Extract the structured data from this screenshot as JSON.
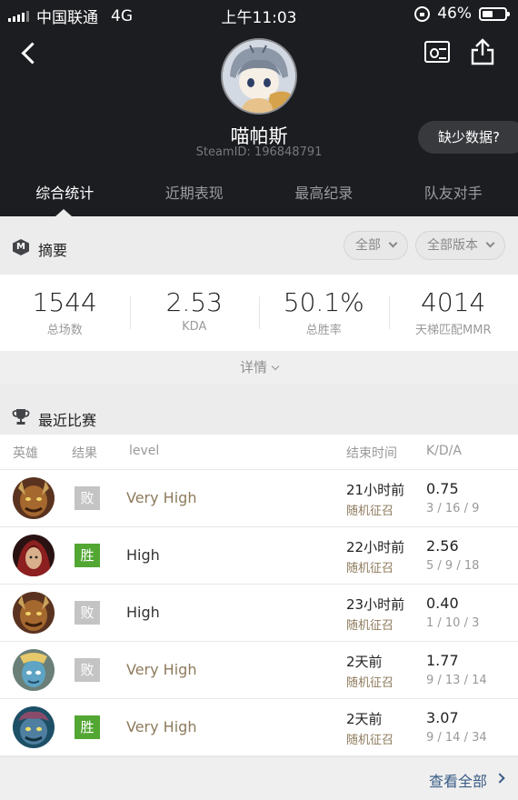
{
  "status_bar": {
    "carrier": "中国联通",
    "network": "4G",
    "time": "上午11:03",
    "battery": "46%",
    "battery_level": 0.46
  },
  "profile": {
    "name": "喵帕斯",
    "steam_id": "SteamID: 196848791",
    "missing_data_label": "缺少数据?"
  },
  "tabs": [
    {
      "label": "综合统计",
      "active": true
    },
    {
      "label": "近期表现",
      "active": false
    },
    {
      "label": "最高纪录",
      "active": false
    },
    {
      "label": "队友对手",
      "active": false
    }
  ],
  "summary": {
    "title": "摘要",
    "filter_all": "全部",
    "filter_version": "全部版本",
    "stats": [
      {
        "value": "1544",
        "label": "总场数"
      },
      {
        "value": "2.53",
        "label": "KDA"
      },
      {
        "value": "50.1%",
        "label": "总胜率"
      },
      {
        "value": "4014",
        "label": "天梯匹配MMR"
      }
    ],
    "details_label": "详情"
  },
  "recent": {
    "title": "最近比赛",
    "columns": {
      "hero": "英雄",
      "result": "结果",
      "level": "level",
      "end_time": "结束时间",
      "kda": "K/D/A"
    },
    "matches": [
      {
        "hero": "hero-1",
        "result": "败",
        "win": false,
        "level": "Very High",
        "end_time": "21小时前",
        "mode": "随机征召",
        "kda": "0.75",
        "kda_detail": "3 / 16 / 9"
      },
      {
        "hero": "hero-2",
        "result": "胜",
        "win": true,
        "level": "High",
        "end_time": "22小时前",
        "mode": "随机征召",
        "kda": "2.56",
        "kda_detail": "5 / 9 / 18"
      },
      {
        "hero": "hero-1",
        "result": "败",
        "win": false,
        "level": "High",
        "end_time": "23小时前",
        "mode": "随机征召",
        "kda": "0.40",
        "kda_detail": "1 / 10 / 3"
      },
      {
        "hero": "hero-3",
        "result": "败",
        "win": false,
        "level": "Very High",
        "end_time": "2天前",
        "mode": "随机征召",
        "kda": "1.77",
        "kda_detail": "9 / 13 / 14"
      },
      {
        "hero": "hero-4",
        "result": "胜",
        "win": true,
        "level": "Very High",
        "end_time": "2天前",
        "mode": "随机征召",
        "kda": "3.07",
        "kda_detail": "9 / 14 / 34"
      }
    ],
    "view_all": "查看全部"
  },
  "colors": {
    "header_bg": "#1c1d21",
    "win": "#52a632",
    "lose": "#c4c4c4",
    "level_gold": "#8d7a5c",
    "link": "#3a5c86"
  }
}
